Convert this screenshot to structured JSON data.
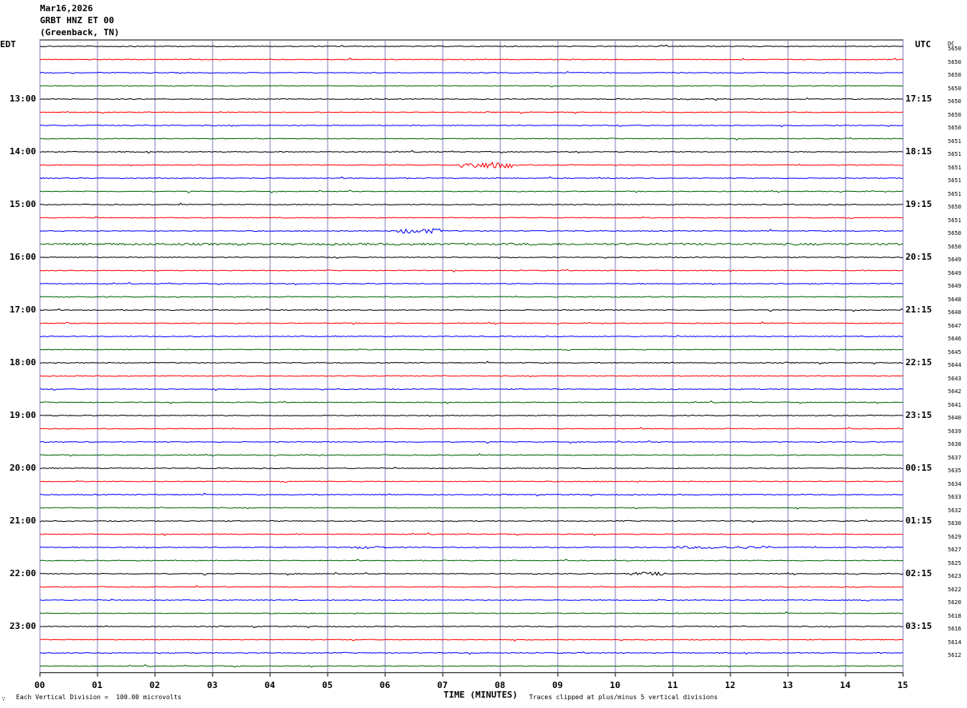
{
  "header": {
    "date": "Mar16,2026",
    "station": "GRBT HNZ ET 00",
    "location": "(Greenback, TN)"
  },
  "left_zone": "EDT",
  "right_zone": "UTC",
  "dc_label": "DC",
  "footer": {
    "scale": "Each Vertical Division =  100.00 microvolts",
    "clip": "Traces clipped at plus/minus 5 vertical divisions",
    "corner_mark": "∵"
  },
  "colors": {
    "black": "#000000",
    "red": "#ff0000",
    "blue": "#0000ff",
    "green": "#006400",
    "grid": "#8080c0"
  },
  "chart_data": {
    "type": "line",
    "title": "",
    "xlabel": "TIME (MINUTES)",
    "ylabel": "",
    "xlim": [
      0,
      15
    ],
    "x_ticks": [
      "00",
      "01",
      "02",
      "03",
      "04",
      "05",
      "06",
      "07",
      "08",
      "09",
      "10",
      "11",
      "12",
      "13",
      "14",
      "15"
    ],
    "line_colors_cycle": [
      "black",
      "red",
      "blue",
      "green"
    ],
    "trace_count": 48,
    "left_time_labels": [
      "13:00",
      "14:00",
      "15:00",
      "16:00",
      "17:00",
      "18:00",
      "19:00",
      "20:00",
      "21:00",
      "22:00",
      "23:00"
    ],
    "right_time_labels": [
      "17:15",
      "18:15",
      "19:15",
      "20:15",
      "21:15",
      "22:15",
      "23:15",
      "00:15",
      "01:15",
      "02:15",
      "03:15"
    ],
    "dc_values": [
      "5650",
      "5650",
      "5650",
      "5650",
      "5650",
      "5650",
      "5650",
      "5651",
      "5651",
      "5651",
      "5651",
      "5651",
      "5650",
      "5651",
      "5650",
      "5650",
      "5649",
      "5649",
      "5649",
      "5648",
      "5648",
      "5647",
      "5646",
      "5645",
      "5644",
      "5643",
      "5642",
      "5641",
      "5640",
      "5639",
      "5638",
      "5637",
      "5635",
      "5634",
      "5633",
      "5632",
      "5630",
      "5629",
      "5627",
      "5625",
      "5623",
      "5622",
      "5620",
      "5618",
      "5616",
      "5614",
      "5612"
    ],
    "events": [
      {
        "trace": 9,
        "start_min": 7.3,
        "end_min": 8.2,
        "amp": 4
      },
      {
        "trace": 14,
        "start_min": 6.2,
        "end_min": 7.0,
        "amp": 3
      },
      {
        "trace": 15,
        "start_min": 0,
        "end_min": 15,
        "amp": 1.2
      },
      {
        "trace": 40,
        "start_min": 10.2,
        "end_min": 10.9,
        "amp": 2
      },
      {
        "trace": 38,
        "start_min": 5.4,
        "end_min": 6.0,
        "amp": 1.5
      },
      {
        "trace": 38,
        "start_min": 11.0,
        "end_min": 12.7,
        "amp": 1.5
      }
    ],
    "grid": true
  }
}
